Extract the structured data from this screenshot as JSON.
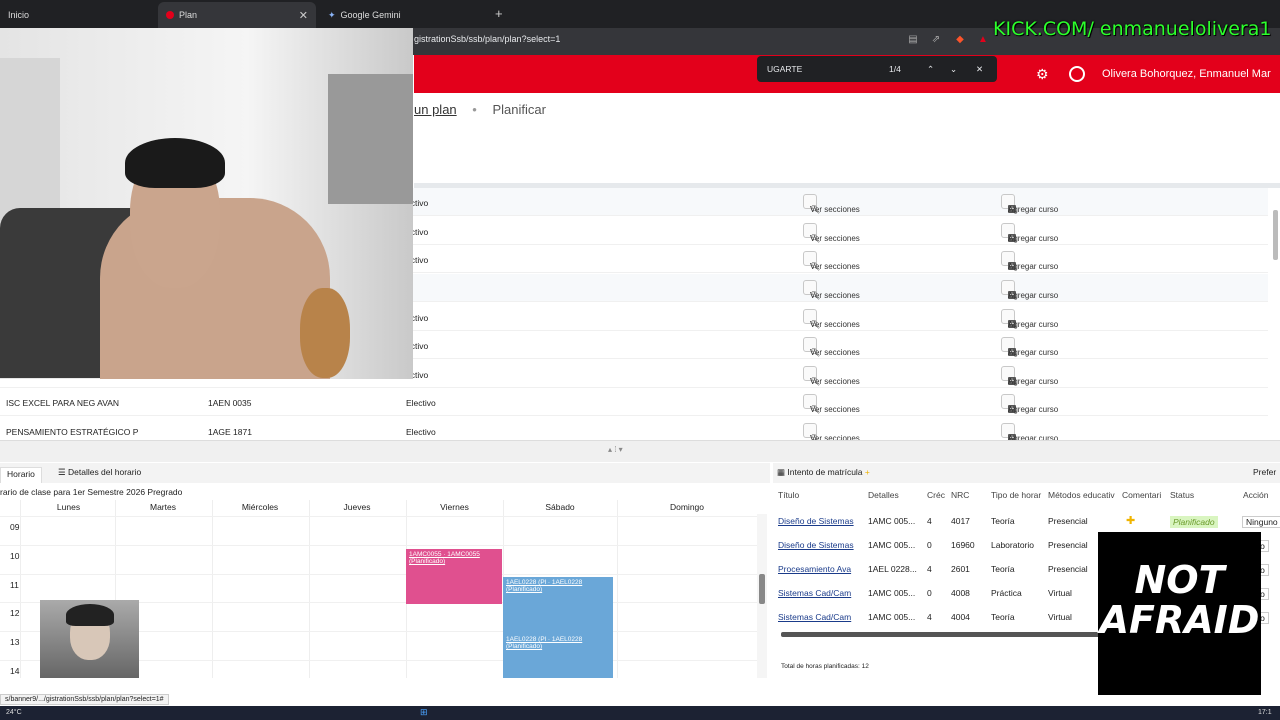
{
  "browser": {
    "tabs": [
      {
        "label": "Inicio"
      },
      {
        "label": "Plan"
      },
      {
        "label": "Google Gemini"
      }
    ],
    "url": "gistrationSsb/ssb/plan/plan?select=1",
    "status_url": "s/banner9/.../gistrationSsb/ssb/plan/plan?select=1#"
  },
  "overlay": {
    "kick_text": "KICK.COM/ enmanuelolivera1",
    "not_afraid": "NOT AFRAID"
  },
  "find": {
    "query": "UGARTE",
    "count": "1/4"
  },
  "header": {
    "user": "Olivera Bohorquez, Enmanuel Mar"
  },
  "breadcrumb": {
    "link": "un plan",
    "current": "Planificar"
  },
  "courses": {
    "ver_label": "Ver secciones",
    "agregar_label": "Agregar curso",
    "rows": [
      {
        "title": "",
        "code": "",
        "type": "ectivo"
      },
      {
        "title": "",
        "code": "",
        "type": "ectivo"
      },
      {
        "title": "",
        "code": "",
        "type": "ectivo"
      },
      {
        "title": "",
        "code": "",
        "type": ""
      },
      {
        "title": "",
        "code": "",
        "type": "ectivo"
      },
      {
        "title": "",
        "code": "",
        "type": "ectivo"
      },
      {
        "title": "",
        "code": "",
        "type": "ectivo"
      },
      {
        "title": "ISC EXCEL PARA NEG AVAN",
        "code": "1AEN 0035",
        "type": "Electivo"
      },
      {
        "title": "PENSAMIENTO ESTRATÉGICO P",
        "code": "1AGE 1871",
        "type": "Electivo"
      }
    ]
  },
  "schedule": {
    "tab_horario": "Horario",
    "tab_detalles": "Detalles del horario",
    "title": "rario de clase para 1er Semestre 2026 Pregrado",
    "days": [
      "Lunes",
      "Martes",
      "Miércoles",
      "Jueves",
      "Viernes",
      "Sábado",
      "Domingo"
    ],
    "hours": [
      "09",
      "10",
      "11",
      "12",
      "13",
      "14"
    ],
    "events": [
      {
        "text": "1AMC0055 · 1AMC0055 (Planificado)",
        "color": "#e0508f"
      },
      {
        "text": "1AEL0228 (Pl · 1AEL0228 (Planificado)",
        "color": "#6aa7d8"
      },
      {
        "text": "1AEL0228 (Pl · 1AEL0228 (Planificado)",
        "color": "#6aa7d8"
      }
    ]
  },
  "intent": {
    "title": "Intento de matrícula",
    "pref": "Prefer",
    "headers": [
      "Título",
      "Detalles",
      "Créc",
      "NRC",
      "Tipo de horar",
      "Métodos educativ",
      "Comentari",
      "Status",
      "Acción"
    ],
    "rows": [
      {
        "title": "Diseño de Sistemas",
        "det": "1AMC 005...",
        "cred": "4",
        "nrc": "4017",
        "tipo": "Teoría",
        "met": "Presencial",
        "status": "Planificado",
        "accion": "Ninguno"
      },
      {
        "title": "Diseño de Sistemas",
        "det": "1AMC 005...",
        "cred": "0",
        "nrc": "16960",
        "tipo": "Laboratorio",
        "met": "Presencial",
        "status": "",
        "accion": "guno"
      },
      {
        "title": "Procesamiento Ava",
        "det": "1AEL 0228...",
        "cred": "4",
        "nrc": "2601",
        "tipo": "Teoría",
        "met": "Presencial",
        "status": "",
        "accion": "guno"
      },
      {
        "title": "Sistemas Cad/Cam",
        "det": "1AMC 005...",
        "cred": "0",
        "nrc": "4008",
        "tipo": "Práctica",
        "met": "Virtual",
        "status": "",
        "accion": "guno"
      },
      {
        "title": "Sistemas Cad/Cam",
        "det": "1AMC 005...",
        "cred": "4",
        "nrc": "4004",
        "tipo": "Teoría",
        "met": "Virtual",
        "status": "",
        "accion": "guno"
      }
    ],
    "total": "Total de horas planificadas: 12"
  },
  "taskbar": {
    "temp": "24°C",
    "time": "17:1"
  },
  "colors": {
    "brand_red": "#e3001b",
    "kick_green": "#2cff2c"
  }
}
